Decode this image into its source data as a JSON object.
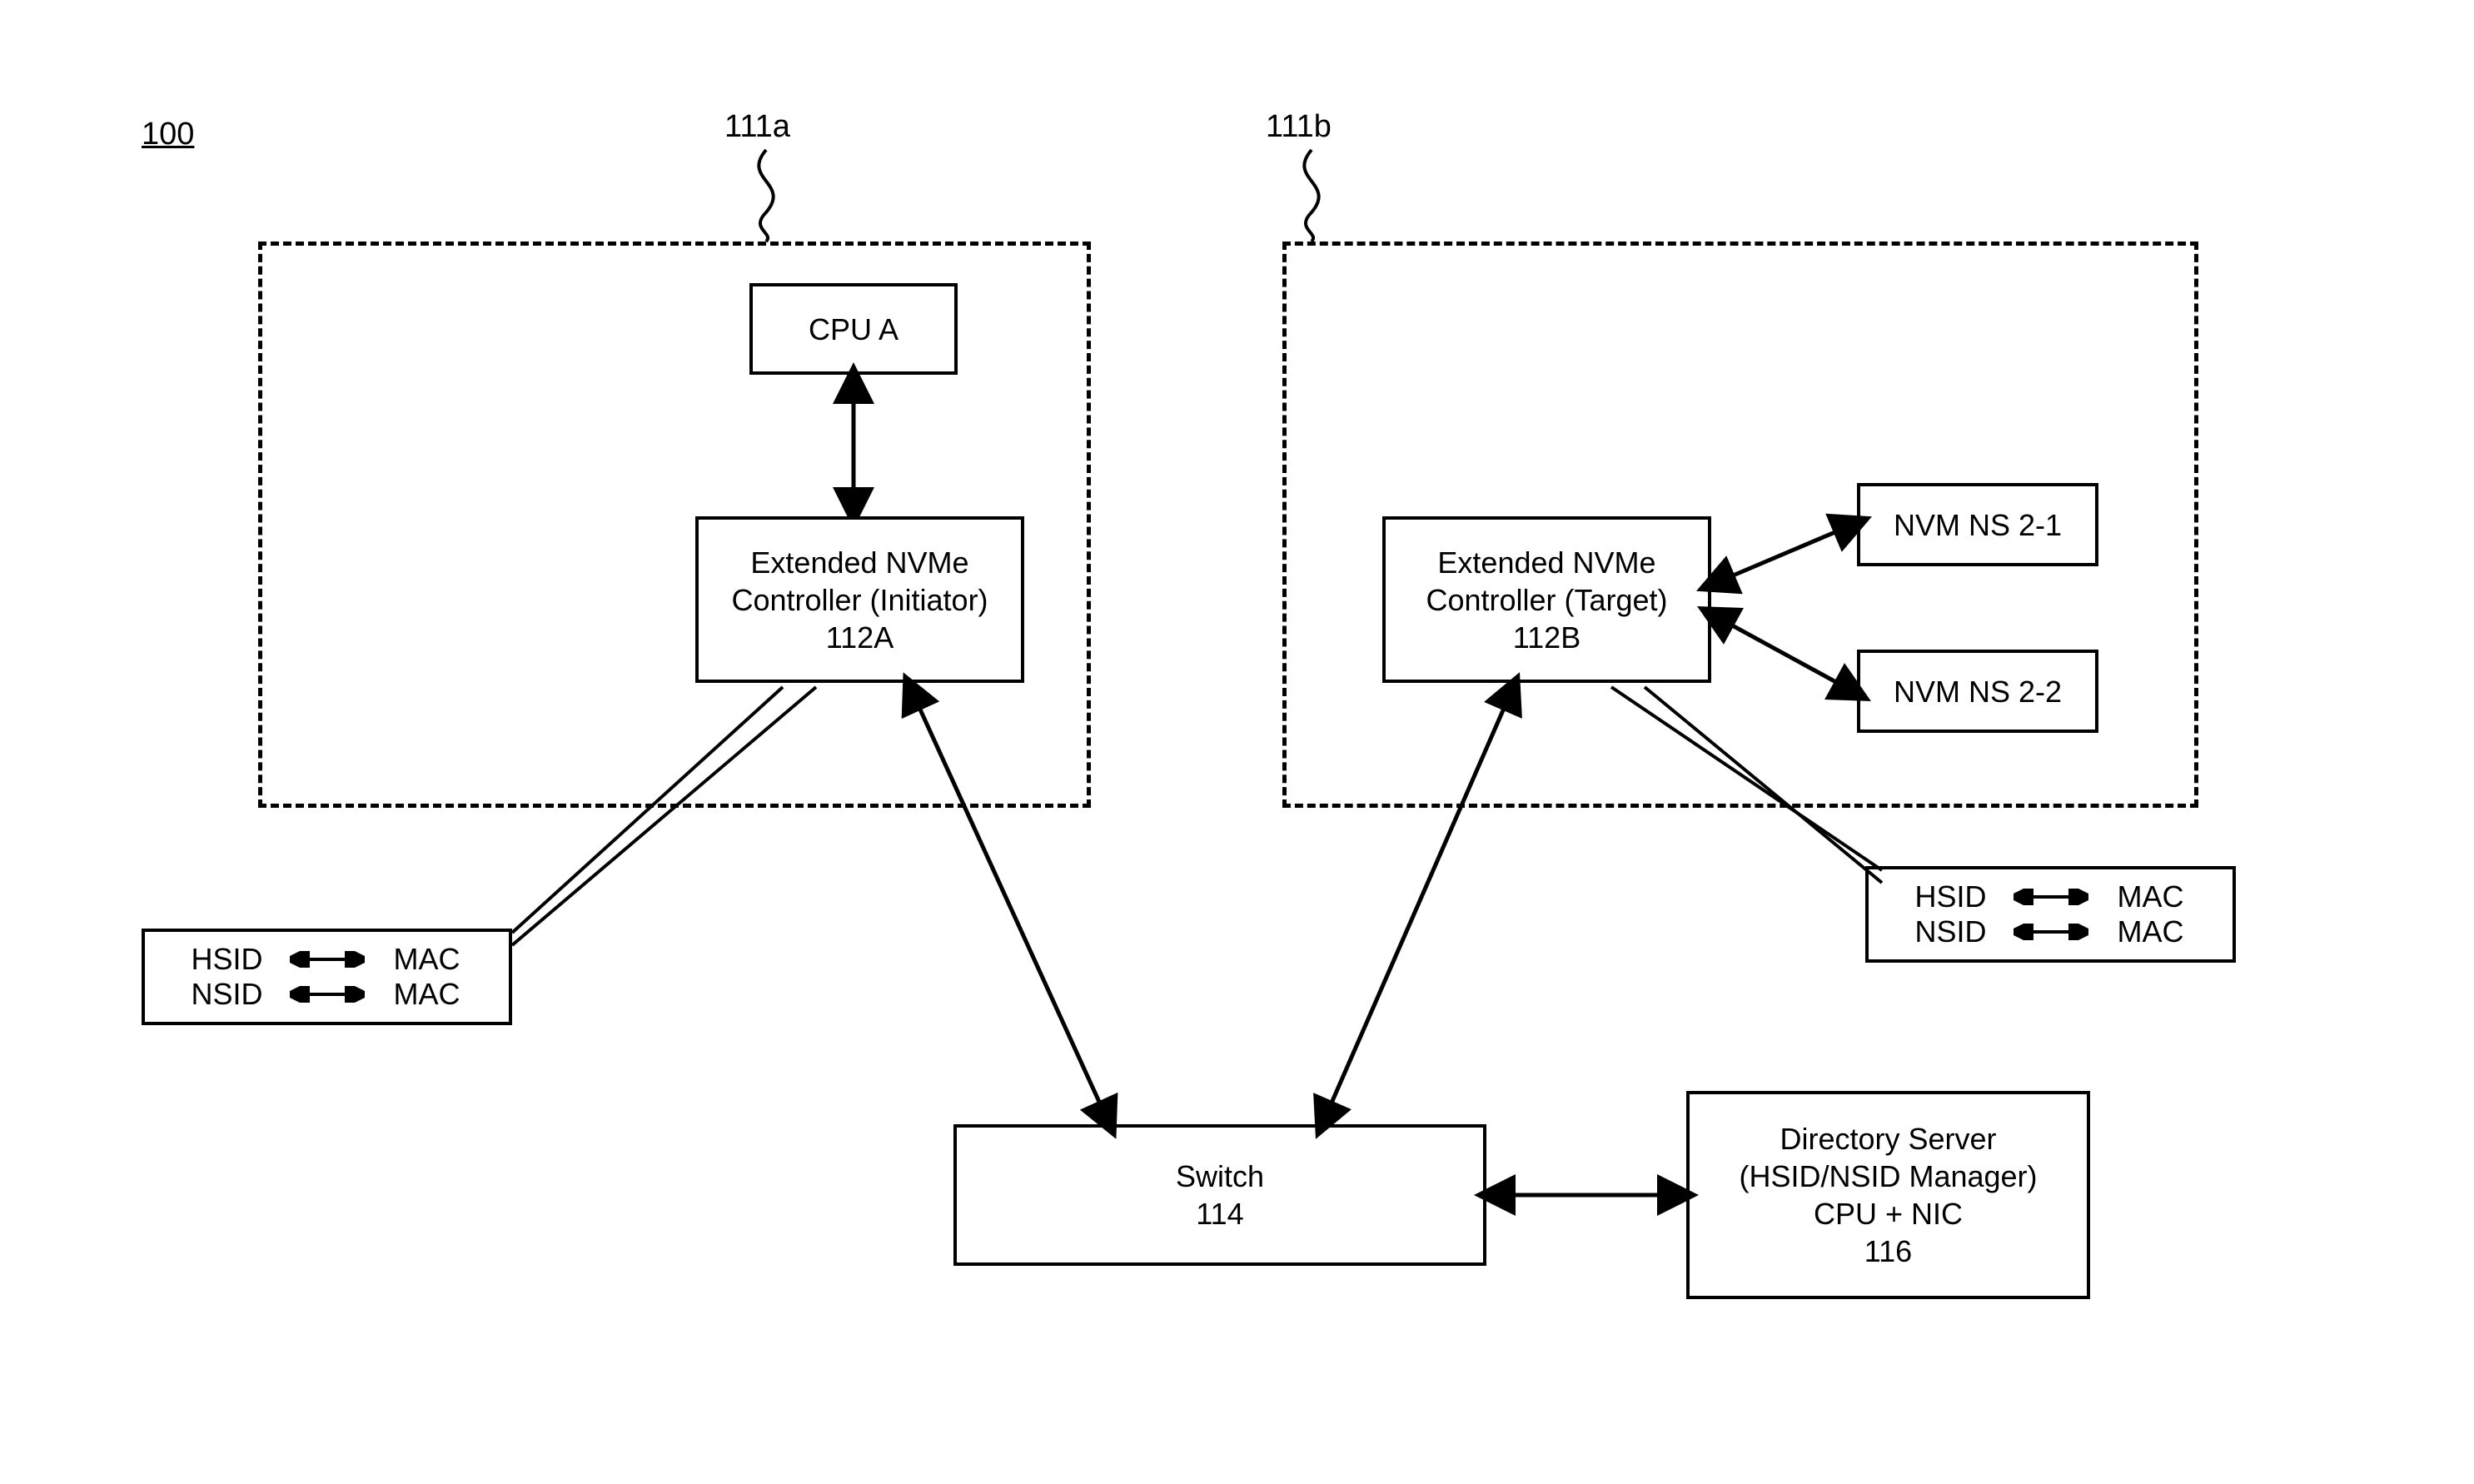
{
  "figure_ref": "100",
  "host_a": {
    "ref": "111a",
    "cpu_label": "CPU A",
    "controller_line1": "Extended NVMe",
    "controller_line2": "Controller (Initiator)",
    "controller_ref": "112A"
  },
  "host_b": {
    "ref": "111b",
    "controller_line1": "Extended NVMe",
    "controller_line2": "Controller (Target)",
    "controller_ref": "112B",
    "ns1_label": "NVM NS 2-1",
    "ns2_label": "NVM NS 2-2"
  },
  "mapping_a": {
    "row1_left": "HSID",
    "row1_right": "MAC",
    "row2_left": "NSID",
    "row2_right": "MAC"
  },
  "mapping_b": {
    "row1_left": "HSID",
    "row1_right": "MAC",
    "row2_left": "NSID",
    "row2_right": "MAC"
  },
  "switch": {
    "label": "Switch",
    "ref": "114"
  },
  "directory": {
    "line1": "Directory Server",
    "line2": "(HSID/NSID Manager)",
    "line3": "CPU + NIC",
    "ref": "116"
  }
}
